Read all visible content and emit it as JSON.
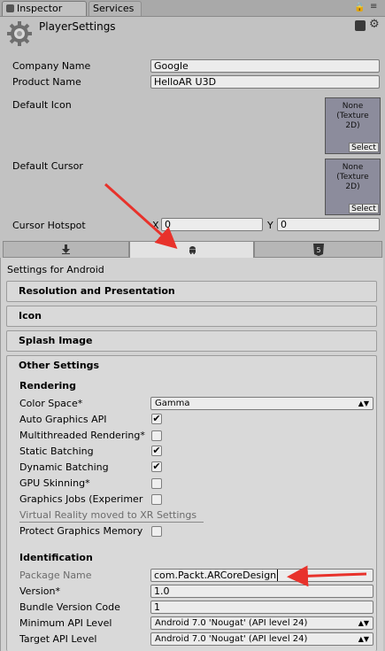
{
  "tabs": [
    {
      "label": "Inspector"
    },
    {
      "label": "Services"
    }
  ],
  "header": {
    "title": "PlayerSettings"
  },
  "fields": {
    "company_name": {
      "label": "Company Name",
      "value": "Google"
    },
    "product_name": {
      "label": "Product Name",
      "value": "HelloAR U3D"
    },
    "default_icon": {
      "label": "Default Icon",
      "line1": "None",
      "line2": "(Texture",
      "line3": "2D)",
      "select": "Select"
    },
    "default_cursor": {
      "label": "Default Cursor",
      "line1": "None",
      "line2": "(Texture",
      "line3": "2D)",
      "select": "Select"
    },
    "cursor_hotspot": {
      "label": "Cursor Hotspot",
      "x_label": "X",
      "x_value": "0",
      "y_label": "Y",
      "y_value": "0"
    }
  },
  "platform": {
    "tabs": [
      "standalone-icon",
      "android-icon",
      "html5-icon"
    ],
    "settings_for": "Settings for Android"
  },
  "sections": {
    "resolution": "Resolution and Presentation",
    "icon": "Icon",
    "splash": "Splash Image",
    "other": "Other Settings"
  },
  "rendering": {
    "heading": "Rendering",
    "color_space": {
      "label": "Color Space*",
      "value": "Gamma"
    },
    "auto_graphics_api": {
      "label": "Auto Graphics API",
      "checked": true
    },
    "multithreaded_rendering": {
      "label": "Multithreaded Rendering*",
      "checked": false
    },
    "static_batching": {
      "label": "Static Batching",
      "checked": true
    },
    "dynamic_batching": {
      "label": "Dynamic Batching",
      "checked": true
    },
    "gpu_skinning": {
      "label": "GPU Skinning*",
      "checked": false
    },
    "graphics_jobs": {
      "label": "Graphics Jobs (Experimer",
      "checked": false
    },
    "vr_note": "Virtual Reality moved to XR Settings",
    "protect_graphics_memory": {
      "label": "Protect Graphics Memory",
      "checked": false
    }
  },
  "identification": {
    "heading": "Identification",
    "package_name": {
      "label": "Package Name",
      "value": "com.Packt.ARCoreDesign"
    },
    "version": {
      "label": "Version*",
      "value": "1.0"
    },
    "bundle_version_code": {
      "label": "Bundle Version Code",
      "value": "1"
    },
    "min_api_level": {
      "label": "Minimum API Level",
      "value": "Android 7.0 'Nougat' (API level 24)"
    },
    "target_api_level": {
      "label": "Target API Level",
      "value": "Android 7.0 'Nougat' (API level 24)"
    }
  },
  "annotation_color": "#e8322b",
  "check_mark": "✔",
  "dropdown_arrow": "▲▼"
}
